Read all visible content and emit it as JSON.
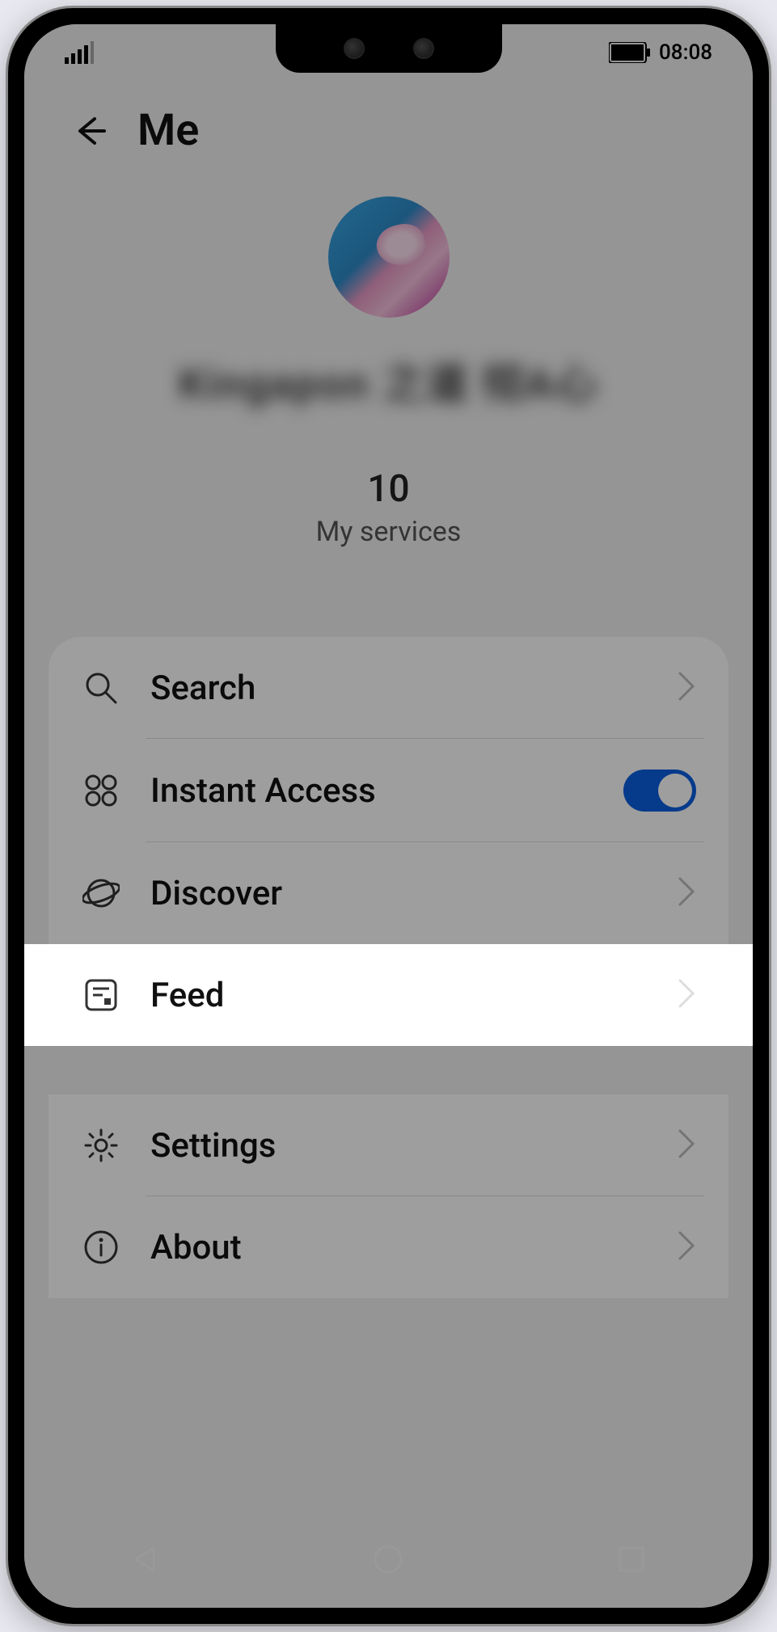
{
  "status": {
    "time": "08:08"
  },
  "header": {
    "title": "Me"
  },
  "profile": {
    "username": "Kingapon  之道 彻A心",
    "stat_count": "10",
    "stat_label": "My services"
  },
  "menu": {
    "search": "Search",
    "instant_access": "Instant Access",
    "discover": "Discover",
    "feed": "Feed",
    "settings": "Settings",
    "about": "About"
  },
  "toggles": {
    "instant_access_on": true
  }
}
